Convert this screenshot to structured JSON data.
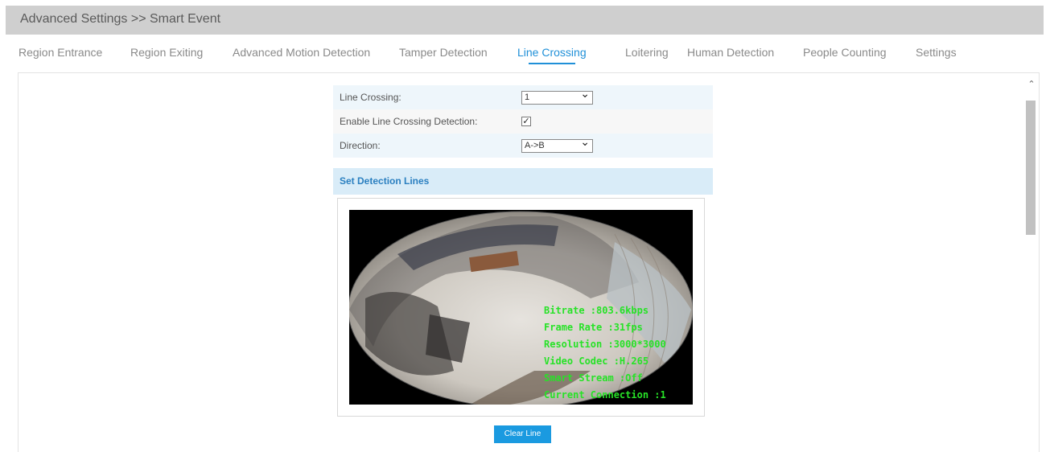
{
  "header": {
    "breadcrumb": "Advanced Settings >> Smart Event"
  },
  "tabs": [
    {
      "label": "Region Entrance"
    },
    {
      "label": "Region Exiting"
    },
    {
      "label": "Advanced Motion Detection"
    },
    {
      "label": "Tamper Detection"
    },
    {
      "label": "Line Crossing",
      "active": true
    },
    {
      "label": "Loitering"
    },
    {
      "label": "Human Detection"
    },
    {
      "label": "People Counting"
    },
    {
      "label": "Settings"
    }
  ],
  "form": {
    "line_crossing_label": "Line Crossing:",
    "line_crossing_value": "1",
    "enable_label": "Enable Line Crossing Detection:",
    "enable_checked": true,
    "direction_label": "Direction:",
    "direction_value": "A->B"
  },
  "section": {
    "title": "Set Detection Lines"
  },
  "video": {
    "osd": [
      "Bitrate :803.6kbps",
      "Frame Rate :31fps",
      "Resolution :3000*3000",
      "Video Codec :H.265",
      "Smart Stream :Off",
      "Current Connection :1"
    ]
  },
  "buttons": {
    "clear_line": "Clear Line"
  },
  "colors": {
    "accent": "#2090d8",
    "button": "#1a9ae0",
    "section_bg": "#d9ecf8",
    "osd_text": "#27e227"
  }
}
